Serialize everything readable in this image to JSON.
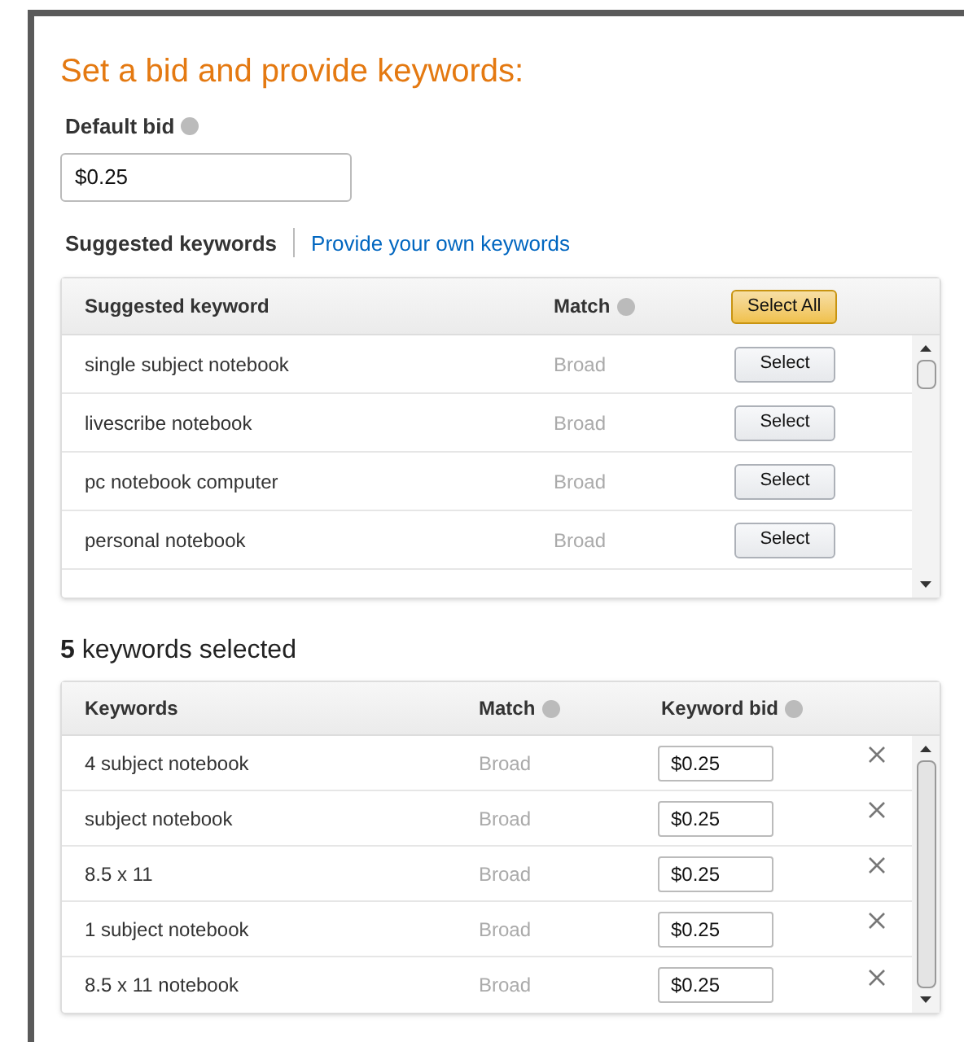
{
  "title": "Set a bid and provide keywords:",
  "default_bid": {
    "label": "Default bid",
    "value": "$0.25"
  },
  "tabs": [
    {
      "label": "Suggested keywords",
      "selected": true
    },
    {
      "label": "Provide your own keywords",
      "selected": false
    }
  ],
  "suggested": {
    "columns": [
      "Suggested keyword",
      "Match"
    ],
    "select_all": "Select All",
    "rows": [
      {
        "keyword": "single subject notebook",
        "match": "Broad",
        "action": "Select"
      },
      {
        "keyword": "livescribe notebook",
        "match": "Broad",
        "action": "Select"
      },
      {
        "keyword": "pc notebook computer",
        "match": "Broad",
        "action": "Select"
      },
      {
        "keyword": "personal notebook",
        "match": "Broad",
        "action": "Select"
      }
    ]
  },
  "selected_summary": {
    "count": "5",
    "text": "keywords selected"
  },
  "selected": {
    "columns": [
      "Keywords",
      "Match",
      "Keyword bid"
    ],
    "rows": [
      {
        "keyword": "4 subject notebook",
        "match": "Broad",
        "bid": "$0.25"
      },
      {
        "keyword": "subject notebook",
        "match": "Broad",
        "bid": "$0.25"
      },
      {
        "keyword": "8.5 x 11",
        "match": "Broad",
        "bid": "$0.25"
      },
      {
        "keyword": "1 subject notebook",
        "match": "Broad",
        "bid": "$0.25"
      },
      {
        "keyword": "8.5 x 11 notebook",
        "match": "Broad",
        "bid": "$0.25"
      }
    ]
  }
}
